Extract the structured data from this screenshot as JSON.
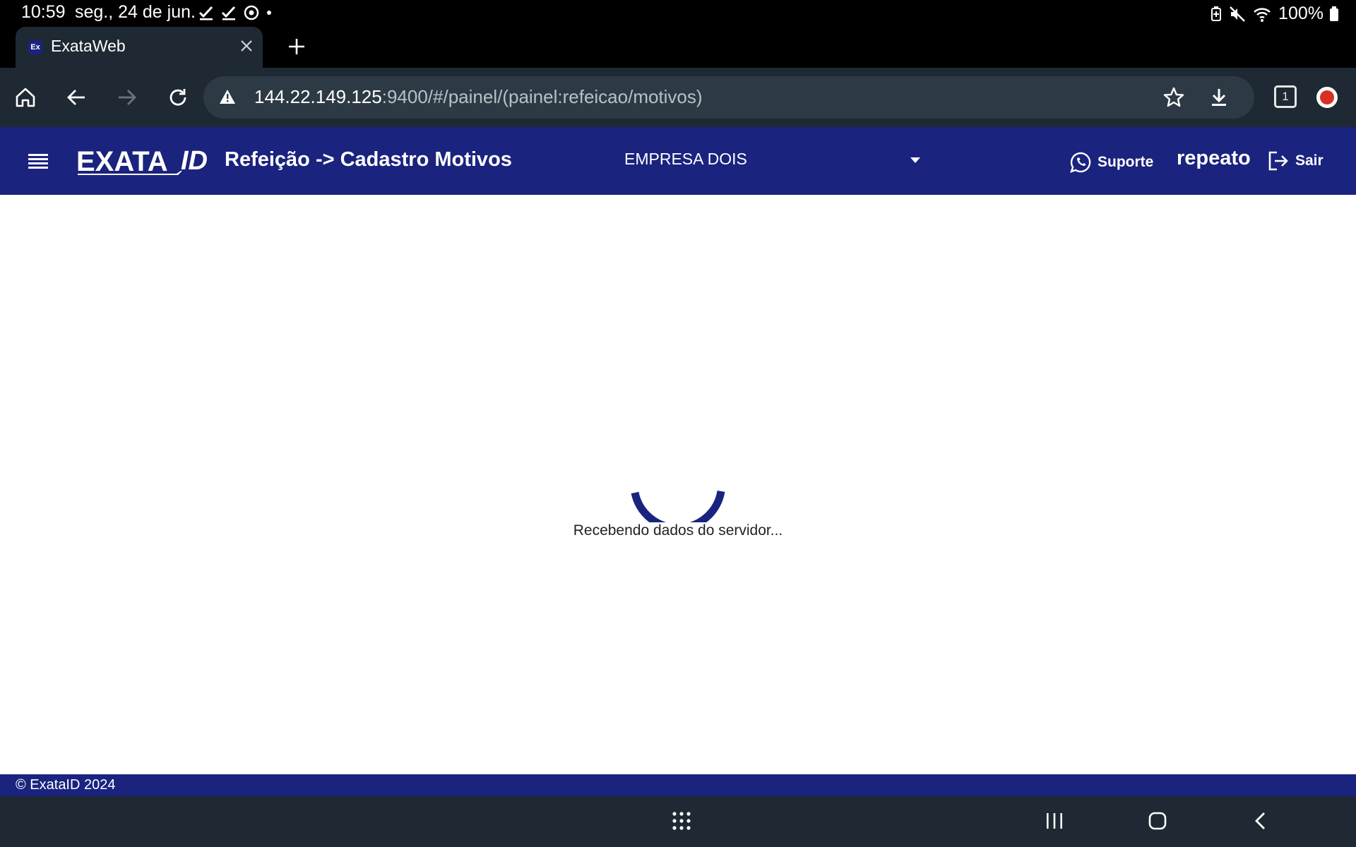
{
  "status_bar": {
    "time": "10:59",
    "date": "seg., 24 de jun.",
    "battery": "100%",
    "icons": [
      "check-icon",
      "check-icon",
      "pokeball-icon",
      "dot-icon",
      "battery-saver-icon",
      "mute-icon",
      "wifi-icon",
      "battery-icon"
    ]
  },
  "browser": {
    "tab_title": "ExataWeb",
    "tab_favicon": "Ex",
    "url_host": "144.22.149.125",
    "url_path": ":9400/#/painel/(painel:refeicao/motivos)",
    "tab_count": "1"
  },
  "app": {
    "page_title": "Refeição -> Cadastro Motivos",
    "company_selected": "EMPRESA DOIS",
    "support_label": "Suporte",
    "username": "repeato",
    "logout_label": "Sair"
  },
  "loading": {
    "message": "Recebendo dados do servidor..."
  },
  "footer": {
    "copyright": "© ExataID 2024"
  },
  "colors": {
    "brand": "#1a237e",
    "browser_chrome": "#1f2933",
    "status_bar": "#000000"
  }
}
